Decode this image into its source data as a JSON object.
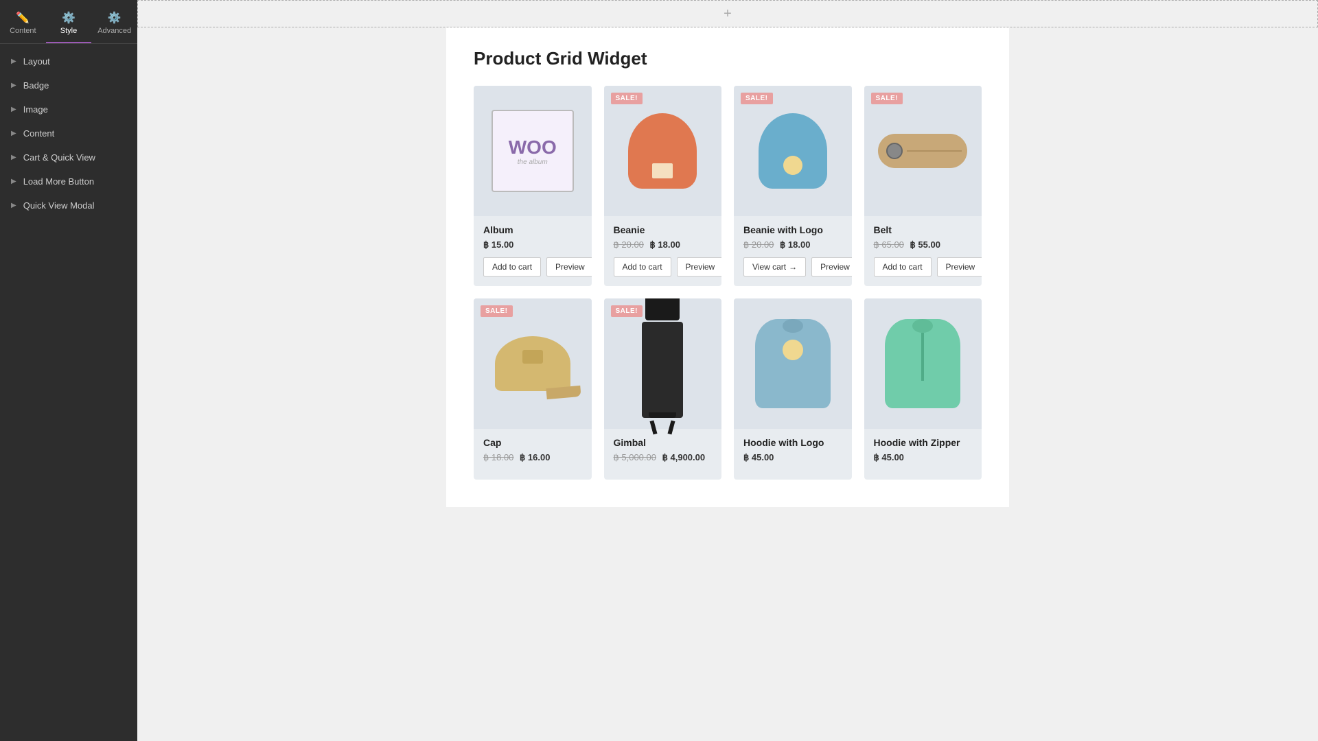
{
  "sidebar": {
    "tabs": [
      {
        "id": "content",
        "label": "Content",
        "icon": "✏️",
        "active": false
      },
      {
        "id": "style",
        "label": "Style",
        "icon": "⚙️",
        "active": true
      },
      {
        "id": "advanced",
        "label": "Advanced",
        "icon": "⚙️",
        "active": false
      }
    ],
    "nav_items": [
      {
        "id": "layout",
        "label": "Layout"
      },
      {
        "id": "badge",
        "label": "Badge"
      },
      {
        "id": "image",
        "label": "Image"
      },
      {
        "id": "content",
        "label": "Content"
      },
      {
        "id": "cart-quick-view",
        "label": "Cart & Quick View"
      },
      {
        "id": "load-more-button",
        "label": "Load More Button"
      },
      {
        "id": "quick-view-modal",
        "label": "Quick View Modal"
      }
    ]
  },
  "main": {
    "add_section_icon": "+",
    "widget_title": "Product Grid Widget",
    "products": [
      {
        "id": "album",
        "name": "Album",
        "sale": false,
        "price_regular": "฿ 15.00",
        "price_original": null,
        "price_sale": null,
        "actions": [
          "add_to_cart",
          "preview"
        ]
      },
      {
        "id": "beanie",
        "name": "Beanie",
        "sale": true,
        "price_original": "฿ 20.00",
        "price_sale": "฿ 18.00",
        "actions": [
          "add_to_cart",
          "preview"
        ]
      },
      {
        "id": "beanie-with-logo",
        "name": "Beanie with Logo",
        "sale": true,
        "price_original": "฿ 20.00",
        "price_sale": "฿ 18.00",
        "actions": [
          "view_cart",
          "preview"
        ]
      },
      {
        "id": "belt",
        "name": "Belt",
        "sale": true,
        "price_original": "฿ 65.00",
        "price_sale": "฿ 55.00",
        "actions": [
          "add_to_cart",
          "preview"
        ]
      },
      {
        "id": "cap",
        "name": "Cap",
        "sale": true,
        "price_original": "฿ 18.00",
        "price_sale": "฿ 16.00",
        "actions": []
      },
      {
        "id": "gimbal",
        "name": "Gimbal",
        "sale": true,
        "price_original": "฿ 5,000.00",
        "price_sale": "฿ 4,900.00",
        "actions": []
      },
      {
        "id": "hoodie-with-logo",
        "name": "Hoodie with Logo",
        "sale": false,
        "price_regular": "฿ 45.00",
        "price_original": null,
        "price_sale": null,
        "actions": []
      },
      {
        "id": "hoodie-with-zipper",
        "name": "Hoodie with Zipper",
        "sale": false,
        "price_regular": "฿ 45.00",
        "price_original": null,
        "price_sale": null,
        "actions": []
      }
    ],
    "buttons": {
      "add_to_cart": "Add to cart",
      "view_cart": "View cart",
      "preview": "Preview",
      "sale_badge": "SALE!"
    }
  }
}
